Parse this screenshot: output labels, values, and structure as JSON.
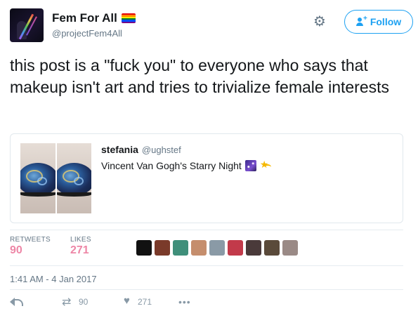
{
  "author": {
    "display_name": "Fem For All",
    "handle": "@projectFem4All",
    "flag_colors": [
      "#e40303",
      "#ff8c00",
      "#ffed00",
      "#008026",
      "#004dff",
      "#750787"
    ]
  },
  "header": {
    "gear_icon": "gear-icon",
    "follow_label": "Follow",
    "accent": "#1da1f2"
  },
  "tweet": {
    "text": "this post is a \"fuck you\" to everyone who says that makeup isn't art and tries to trivialize female interests"
  },
  "quote": {
    "name": "stefania",
    "handle": "@ughstef",
    "text": "Vincent Van Gogh's Starry Night",
    "emojis": [
      "night-with-stars-emoji",
      "dizzy-emoji"
    ]
  },
  "stats": {
    "retweets_label": "RETWEETS",
    "retweets_value": "90",
    "likes_label": "LIKES",
    "likes_value": "271",
    "likers": [
      "#111111",
      "#7a3a2a",
      "#3f8f7a",
      "#c58e6d",
      "#8a9aa6",
      "#c23a4a",
      "#4a3a3a",
      "#5a4a3a",
      "#9a8a86"
    ]
  },
  "timestamp": "1:41 AM - 4 Jan 2017",
  "actions": {
    "reply_icon": "reply-icon",
    "retweet_count": "90",
    "like_count": "271",
    "more_icon": "more-icon"
  }
}
